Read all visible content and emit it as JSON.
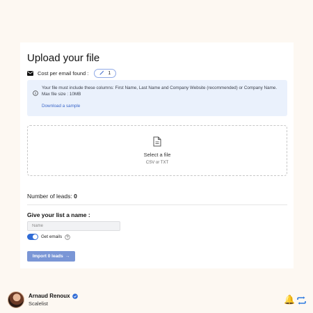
{
  "upload": {
    "title": "Upload your file",
    "cost_label": "Cost per email found :",
    "cost_value": "1",
    "info_text": "Your file must include these columns: First Name, Last Name and Company Website (recommended) or Company Name. Max file size : 10MB",
    "info_link": "Download a sample",
    "dropzone_label": "Select a file",
    "dropzone_formats": "CSV or TXT",
    "leads_label": "Number of leads:",
    "leads_count": "0",
    "name_heading": "Give your list a name :",
    "name_placeholder": "Name",
    "name_value": "",
    "get_emails_label": "Get emails",
    "get_emails_enabled": true,
    "import_label": "Import 0 leads",
    "import_arrow": "→"
  },
  "author": {
    "name": "Arnaud Renoux",
    "company": "Scalelist",
    "verified": true
  },
  "colors": {
    "page_bg": "#fdf8f2",
    "accent": "#2f6bd6",
    "info_bg": "#eaf1fc",
    "button_bg": "#7a96d6"
  },
  "icons": [
    "mail-icon",
    "wand-icon",
    "info-icon",
    "file-icon",
    "help-icon",
    "verified-icon",
    "bell-icon",
    "repost-icon"
  ]
}
